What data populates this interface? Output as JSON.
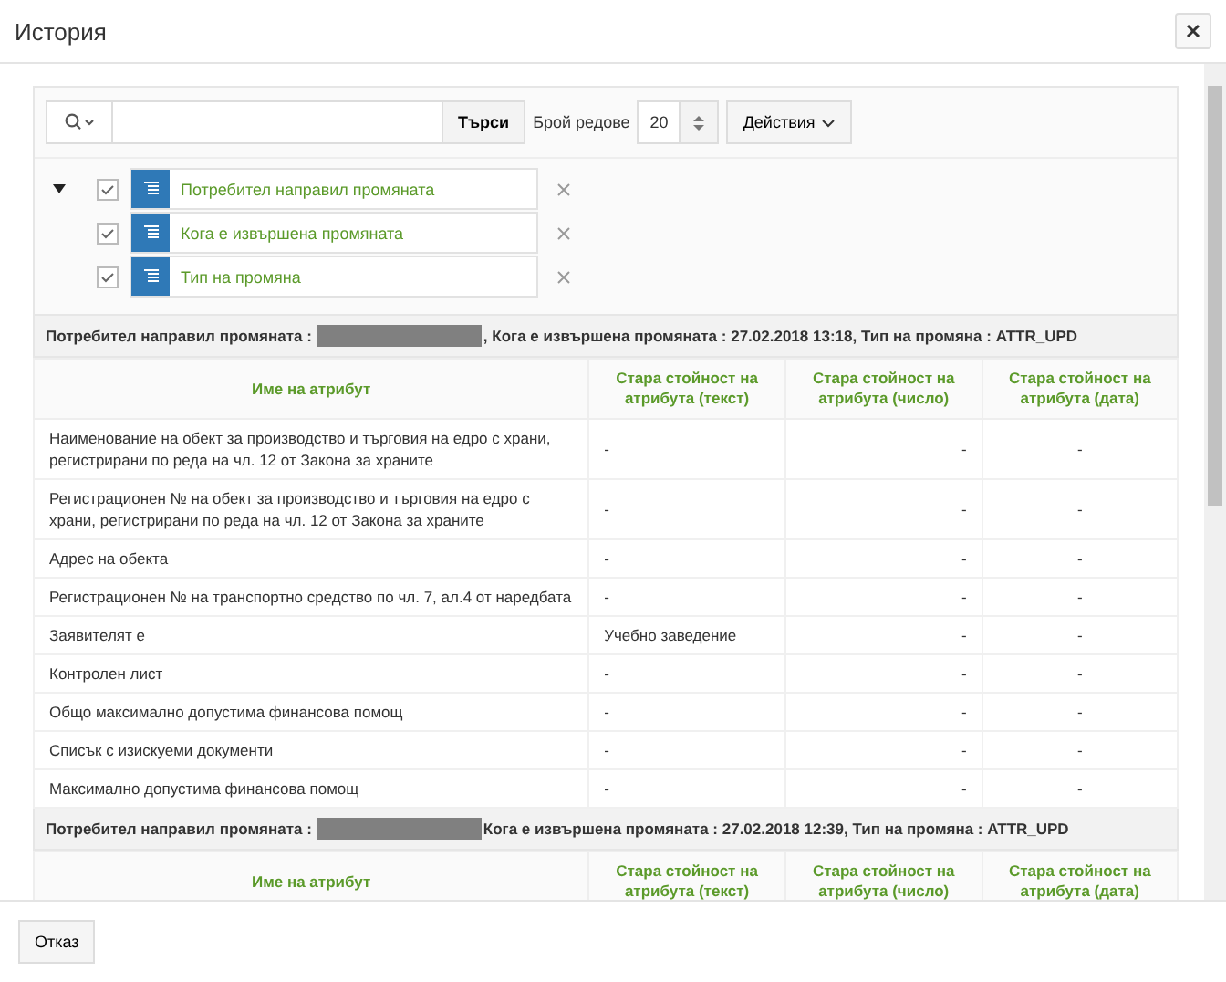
{
  "window": {
    "title": "История"
  },
  "toolbar": {
    "search_button": "Търси",
    "rows_label": "Брой редове",
    "rows_value": "20",
    "actions": "Действия"
  },
  "filters": {
    "expanded": true,
    "items": [
      {
        "label": "Потребител направил промяната",
        "checked": true
      },
      {
        "label": "Кога е извършена промяната",
        "checked": true
      },
      {
        "label": "Тип на промяна",
        "checked": true
      }
    ]
  },
  "groups": [
    {
      "prefix": "Потребител направил промяната :",
      "suffix": ", Кога е извършена промяната : 27.02.2018 13:18, Тип на промяна : ATTR_UPD",
      "columns": [
        "Име на атрибут",
        "Стара стойност на атрибута (текст)",
        "Стара стойност на атрибута (число)",
        "Стара стойност на атрибута (дата)"
      ],
      "rows": [
        [
          "Наименование на обект за производство и търговия на едро с храни, регистрирани по реда на чл. 12 от Закона за храните",
          "-",
          "-",
          "-"
        ],
        [
          "Регистрационен № на обект за производство и търговия на едро с храни, регистрирани по реда на чл. 12 от Закона за храните",
          "-",
          "-",
          "-"
        ],
        [
          "Адрес на обекта",
          "-",
          "-",
          "-"
        ],
        [
          "Регистрационен № на транспортно средство по чл. 7, ал.4 от наредбата",
          "-",
          "-",
          "-"
        ],
        [
          "Заявителят е",
          "Учебно заведение",
          "-",
          "-"
        ],
        [
          "Контролен лист",
          "-",
          "-",
          "-"
        ],
        [
          "Общо максимално допустима финансова помощ",
          "-",
          "-",
          "-"
        ],
        [
          "Списък с изискуеми документи",
          "-",
          "-",
          "-"
        ],
        [
          "Максимално допустима финансова помощ",
          "-",
          "-",
          "-"
        ]
      ]
    },
    {
      "prefix": "Потребител направил промяната :",
      "suffix": "Кога е извършена промяната : 27.02.2018 12:39, Тип на промяна : ATTR_UPD",
      "columns": [
        "Име на атрибут",
        "Стара стойност на атрибута (текст)",
        "Стара стойност на атрибута (число)",
        "Стара стойност на атрибута (дата)"
      ]
    }
  ],
  "footer": {
    "cancel": "Отказ"
  }
}
